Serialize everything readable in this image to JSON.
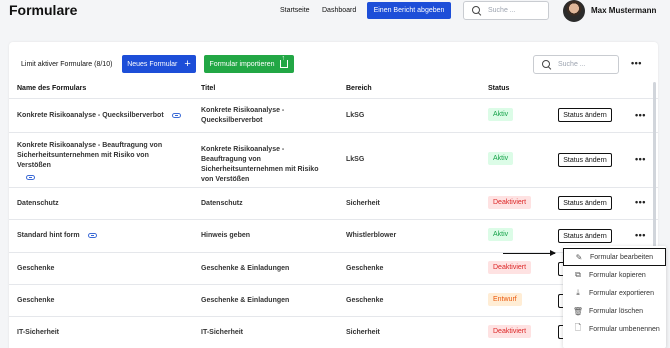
{
  "header": {
    "title": "Formulare",
    "nav": [
      "Startseite",
      "Dashboard"
    ],
    "report_button": "Einen Bericht abgeben",
    "search_placeholder": "Suche ...",
    "user_name": "Max Mustermann"
  },
  "toolbar": {
    "limit_label": "Limit aktiver Formulare (8/10)",
    "new_form_label": "Neues Formular",
    "import_label": "Formular importieren",
    "search_placeholder": "Suche ..."
  },
  "table": {
    "columns": [
      "Name des Formulars",
      "Titel",
      "Bereich",
      "Status"
    ],
    "status_button_label": "Status ändern",
    "rows": [
      {
        "name": "Konkrete Risikoanalyse - Quecksilberverbot",
        "title": "Konkrete Risikoanalyse - Quecksilberverbot",
        "area": "LkSG",
        "status": "Aktiv"
      },
      {
        "name": "Konkrete Risikoanalyse - Beauftragung von Sicherheitsunternehmen mit Risiko von Verstößen",
        "title": "Konkrete Risikoanalyse - Beauftragung von Sicherheitsunternehmen mit Risiko von Verstößen",
        "area": "LkSG",
        "status": "Aktiv"
      },
      {
        "name": "Datenschutz",
        "title": "Datenschutz",
        "area": "Sicherheit",
        "status": "Deaktiviert"
      },
      {
        "name": "Standard hint form",
        "title": "Hinweis geben",
        "area": "Whistlerblower",
        "status": "Aktiv"
      },
      {
        "name": "Geschenke",
        "title": "Geschenke & Einladungen",
        "area": "Geschenke",
        "status": "Deaktiviert"
      },
      {
        "name": "Geschenke",
        "title": "Geschenke & Einladungen",
        "area": "Geschenke",
        "status": "Entwurf"
      },
      {
        "name": "IT-Sicherheit",
        "title": "IT-Sicherheit",
        "area": "Sicherheit",
        "status": "Deaktiviert"
      }
    ]
  },
  "context_menu": {
    "items": [
      {
        "label": "Formular bearbeiten",
        "icon": "pencil-icon"
      },
      {
        "label": "Formular kopieren",
        "icon": "copy-icon"
      },
      {
        "label": "Formular exportieren",
        "icon": "download-icon"
      },
      {
        "label": "Formular löschen",
        "icon": "trash-icon"
      },
      {
        "label": "Formular umbenennen",
        "icon": "rename-icon"
      }
    ]
  },
  "colors": {
    "primary": "#1d4ed8",
    "success": "#22a745",
    "aktiv_bg": "#dcfce7",
    "deaktiviert_bg": "#fee2e2",
    "entwurf_bg": "#ffedd5"
  }
}
